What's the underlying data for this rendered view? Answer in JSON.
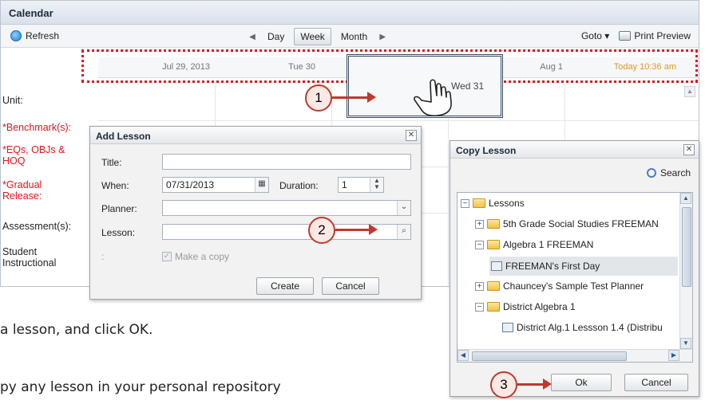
{
  "calendar": {
    "title": "Calendar",
    "refresh_label": "Refresh",
    "views": [
      "Day",
      "Week",
      "Month"
    ],
    "active_view": "Week",
    "goto_label": "Goto ▾",
    "print_label": "Print Preview",
    "days": [
      "Jul 29, 2013",
      "Tue 30",
      "Wed 31",
      "Aug 1"
    ],
    "today_label": "Today 10:36 am",
    "dragged_day": "Wed 31",
    "rows": [
      "Unit:",
      "*Benchmark(s):",
      "*EQs, OBJs & HOQ",
      "*Gradual Release:",
      "Assessment(s):",
      "Student Instructional"
    ]
  },
  "callouts": [
    "1",
    "2",
    "3"
  ],
  "add_lesson": {
    "title": "Add Lesson",
    "title_label": "Title:",
    "when_label": "When:",
    "when_value": "07/31/2013",
    "duration_label": "Duration:",
    "duration_value": "1",
    "planner_label": "Planner:",
    "lesson_label": "Lesson:",
    "extra_label": ":",
    "make_copy_label": "Make a copy",
    "create_label": "Create",
    "cancel_label": "Cancel"
  },
  "copy_lesson": {
    "title": "Copy Lesson",
    "search_label": "Search",
    "tree": [
      {
        "label": "Lessons",
        "toggle": "−",
        "kind": "folder"
      },
      {
        "label": "5th Grade Social Studies FREEMAN",
        "toggle": "+",
        "kind": "folder"
      },
      {
        "label": "Algebra 1 FREEMAN",
        "toggle": "−",
        "kind": "folder"
      },
      {
        "label": "FREEMAN's First Day",
        "toggle": "",
        "kind": "doc"
      },
      {
        "label": "Chauncey's Sample Test Planner",
        "toggle": "+",
        "kind": "folder"
      },
      {
        "label": "District Algebra 1",
        "toggle": "−",
        "kind": "folder"
      },
      {
        "label": "District Alg.1 Lessson 1.4 (Distribu",
        "toggle": "",
        "kind": "doc"
      }
    ],
    "ok_label": "Ok",
    "cancel_label": "Cancel"
  },
  "captions": {
    "line1": "a lesson, and click OK.",
    "line2": "py any lesson in your personal repository"
  },
  "colors": {
    "highlight_red": "#e0141e",
    "callout_border": "#c0392b",
    "today_orange": "#d89a23"
  }
}
